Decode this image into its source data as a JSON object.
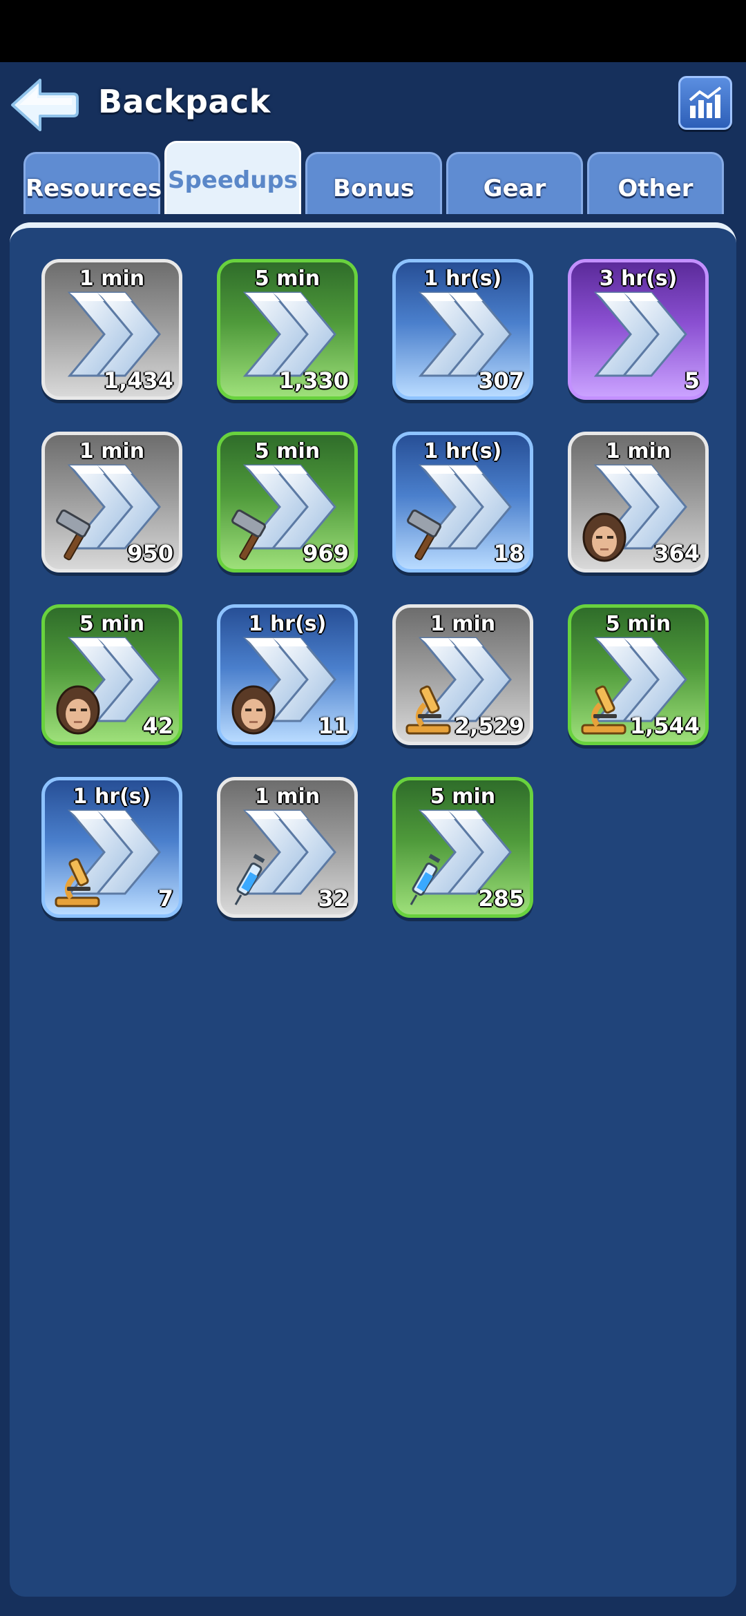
{
  "header": {
    "title": "Backpack",
    "back_icon": "arrow-left-icon",
    "stats_icon": "bar-chart-icon"
  },
  "tabs": [
    {
      "label": "Resources",
      "active": false
    },
    {
      "label": "Speedups",
      "active": true
    },
    {
      "label": "Bonus",
      "active": false
    },
    {
      "label": "Gear",
      "active": false
    },
    {
      "label": "Other",
      "active": false
    }
  ],
  "items": [
    {
      "duration": "1 min",
      "count": "1,434",
      "tier": "grey",
      "badge": ""
    },
    {
      "duration": "5 min",
      "count": "1,330",
      "tier": "green",
      "badge": ""
    },
    {
      "duration": "1 hr(s)",
      "count": "307",
      "tier": "blue",
      "badge": ""
    },
    {
      "duration": "3 hr(s)",
      "count": "5",
      "tier": "purple",
      "badge": ""
    },
    {
      "duration": "1 min",
      "count": "950",
      "tier": "grey",
      "badge": "hammer-icon"
    },
    {
      "duration": "5 min",
      "count": "969",
      "tier": "green",
      "badge": "hammer-icon"
    },
    {
      "duration": "1 hr(s)",
      "count": "18",
      "tier": "blue",
      "badge": "hammer-icon"
    },
    {
      "duration": "1 min",
      "count": "364",
      "tier": "grey",
      "badge": "soldier-icon"
    },
    {
      "duration": "5 min",
      "count": "42",
      "tier": "green",
      "badge": "soldier-icon"
    },
    {
      "duration": "1 hr(s)",
      "count": "11",
      "tier": "blue",
      "badge": "soldier-icon"
    },
    {
      "duration": "1 min",
      "count": "2,529",
      "tier": "grey",
      "badge": "microscope-icon"
    },
    {
      "duration": "5 min",
      "count": "1,544",
      "tier": "green",
      "badge": "microscope-icon"
    },
    {
      "duration": "1 hr(s)",
      "count": "7",
      "tier": "blue",
      "badge": "microscope-icon"
    },
    {
      "duration": "1 min",
      "count": "32",
      "tier": "grey",
      "badge": "syringe-icon"
    },
    {
      "duration": "5 min",
      "count": "285",
      "tier": "green",
      "badge": "syringe-icon"
    }
  ]
}
